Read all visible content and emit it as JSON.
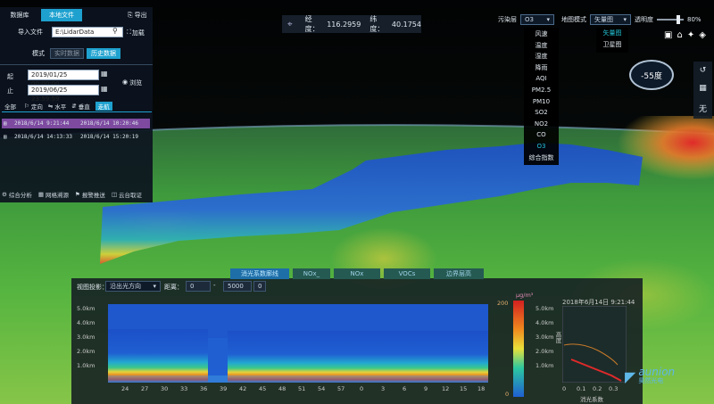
{
  "map": {
    "lon_label": "经度：",
    "lon_value": "116.2959",
    "lat_label": "纬度：",
    "lat_value": "40.1754",
    "compass_value": "-55度"
  },
  "left_panel": {
    "tab_database": "数据库",
    "tab_local_file": "本地文件",
    "export_label": "导出",
    "import_label": "导入文件",
    "import_value": "E:\\LidarData",
    "load_label": "加载",
    "mode_label": "模式",
    "mode_realtime": "实时数据",
    "mode_history": "历史数据",
    "start_label": "起",
    "end_label": "止",
    "start_value": "2019/01/25 00:00:00",
    "end_value": "2019/06/25 23:59:59",
    "browse_label": "浏览",
    "filters": [
      "全部",
      "定向",
      "水平",
      "垂直",
      "走航"
    ],
    "records": [
      {
        "start": "2018/6/14 9:21:44",
        "end": "2018/6/14 10:20:46"
      },
      {
        "start": "2018/6/14 14:13:33",
        "end": "2018/6/14 15:20:19"
      }
    ],
    "bottom_tools": [
      "综合分析",
      "网格溯源",
      "报警推送",
      "云台取证"
    ]
  },
  "top_right": {
    "pollution_layer_label": "污染层",
    "pollution_layer_value": "O3",
    "map_mode_label": "地图模式",
    "map_mode_value": "矢量图",
    "opacity_label": "透明度",
    "opacity_value": "80%",
    "opacity_level": 0.8,
    "pollution_options": [
      "风速",
      "温度",
      "湿度",
      "降雨",
      "AQI",
      "PM2.5",
      "PM10",
      "SO2",
      "NO2",
      "CO",
      "O3",
      "综合指数"
    ],
    "pollution_selected": "O3",
    "map_mode_options": [
      "矢量图",
      "卫星图"
    ]
  },
  "right_tools": [
    "↺",
    "▦",
    "无"
  ],
  "bottom_panel": {
    "tabs": [
      "消光系数廓线",
      "NOx_",
      "NOx",
      "VOCs",
      "边界层高"
    ],
    "view_label": "视图投影：",
    "view_value": "沿出光方向",
    "distance_label": "距离：",
    "dist_from": "0",
    "dist_to": "5000",
    "dist_extra": "0",
    "y_ticks": [
      "5.0km",
      "4.0km",
      "3.0km",
      "2.0km",
      "1.0km"
    ],
    "x_ticks": [
      "24",
      "27",
      "30",
      "33",
      "36",
      "39",
      "42",
      "45",
      "48",
      "51",
      "54",
      "57",
      "0",
      "3",
      "6",
      "9",
      "12",
      "15",
      "18"
    ],
    "colorbar_unit": "μg/m³",
    "colorbar_top": "200",
    "colorbar_bottom": "0",
    "profile_time": "2018年6月14日 9:21:44",
    "profile_yticks": [
      "5.0km",
      "4.0km",
      "3.0km",
      "2.0km",
      "1.0km"
    ],
    "profile_xticks": [
      "0",
      "0.1",
      "0.2",
      "0.3"
    ],
    "profile_xlabel": "消光系数",
    "profile_ylabel": "高度"
  },
  "brand": {
    "name": "aunion",
    "sub": "昊然光电"
  }
}
